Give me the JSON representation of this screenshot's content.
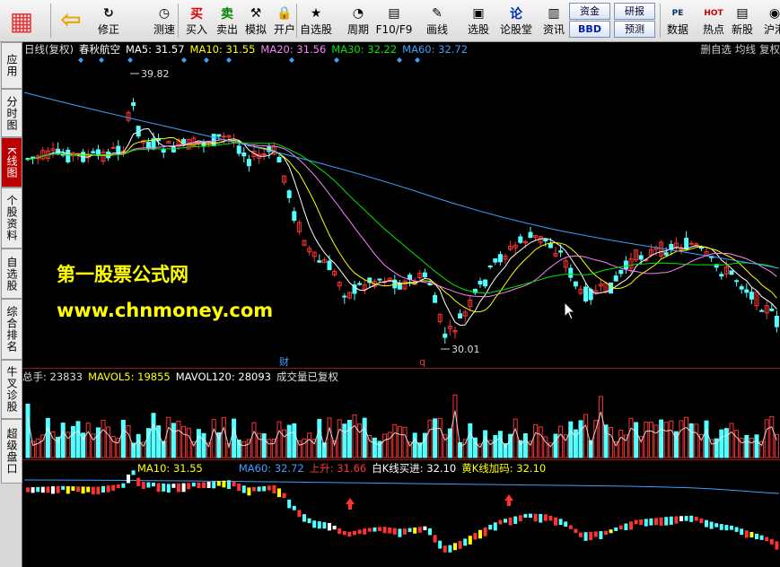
{
  "toolbar": {
    "items": [
      {
        "label": "",
        "icon": "windows-icon"
      },
      {
        "label": "",
        "icon": "back-arrow-icon"
      },
      {
        "label": "修正",
        "icon": "refresh-icon"
      },
      {
        "label": "测速",
        "icon": "clock-icon"
      },
      {
        "label": "买入",
        "icon": "buy-icon",
        "glyph": "买"
      },
      {
        "label": "卖出",
        "icon": "sell-icon",
        "glyph": "卖"
      },
      {
        "label": "模拟",
        "icon": "hammer-icon"
      },
      {
        "label": "开户",
        "icon": "lock-icon"
      },
      {
        "label": "自选股",
        "icon": "star-icon"
      },
      {
        "label": "周期",
        "icon": "period-icon"
      },
      {
        "label": "F10/F9",
        "icon": "f10-icon"
      },
      {
        "label": "画线",
        "icon": "pencil-icon"
      },
      {
        "label": "选股",
        "icon": "select-stock-icon"
      },
      {
        "label": "论股堂",
        "icon": "forum-icon",
        "glyph": "论"
      },
      {
        "label": "资讯",
        "icon": "info-icon"
      },
      {
        "label": "数据",
        "icon": "data-icon",
        "glyph": "PE"
      },
      {
        "label": "热点",
        "icon": "hot-icon",
        "glyph": "HOT"
      },
      {
        "label": "新股",
        "icon": "new-stock-icon"
      },
      {
        "label": "沪港",
        "icon": "hk-icon"
      }
    ],
    "mini_buttons": [
      "资金",
      "研报",
      "BBD",
      "预测"
    ]
  },
  "sidebar": {
    "tabs": [
      "应用",
      "分时图",
      "K线图",
      "个股资料",
      "自选股",
      "综合排名",
      "牛叉诊股",
      "超级盘口"
    ],
    "active_index": 2
  },
  "header": {
    "period": "日线(复权)",
    "stock_name": "春秋航空",
    "ma5": "MA5: 31.57",
    "ma10": "MA10: 31.55",
    "ma20": "MA20: 31.56",
    "ma30": "MA30: 32.22",
    "ma60": "MA60: 32.72",
    "right_buttons": [
      "删自选",
      "均线",
      "复权"
    ]
  },
  "price_panel": {
    "high_label": "39.82",
    "low_label": "30.01",
    "marker_cai": "财",
    "marker_q": "q"
  },
  "watermark": {
    "line1": "第一股票公式网",
    "line2": "www.chnmoney.com"
  },
  "volume_header": {
    "total": "总手: 23833",
    "mavol5": "MAVOL5: 19855",
    "mavol120": "MAVOL120: 28093",
    "note": "成交量已复权"
  },
  "indicator_header": {
    "ma10": "MA10: 31.55",
    "ma60": "MA60: 32.72",
    "up": "上升: 31.66",
    "white_k": "白K线买进: 32.10",
    "yellow_k": "黄K线加码: 32.10"
  },
  "colors": {
    "up": "#ff3232",
    "down": "#54ffff",
    "ma5": "#ffffff",
    "ma10": "#ffff00",
    "ma20": "#ff80ff",
    "ma30": "#00e600",
    "ma60": "#3fa0ff"
  }
}
